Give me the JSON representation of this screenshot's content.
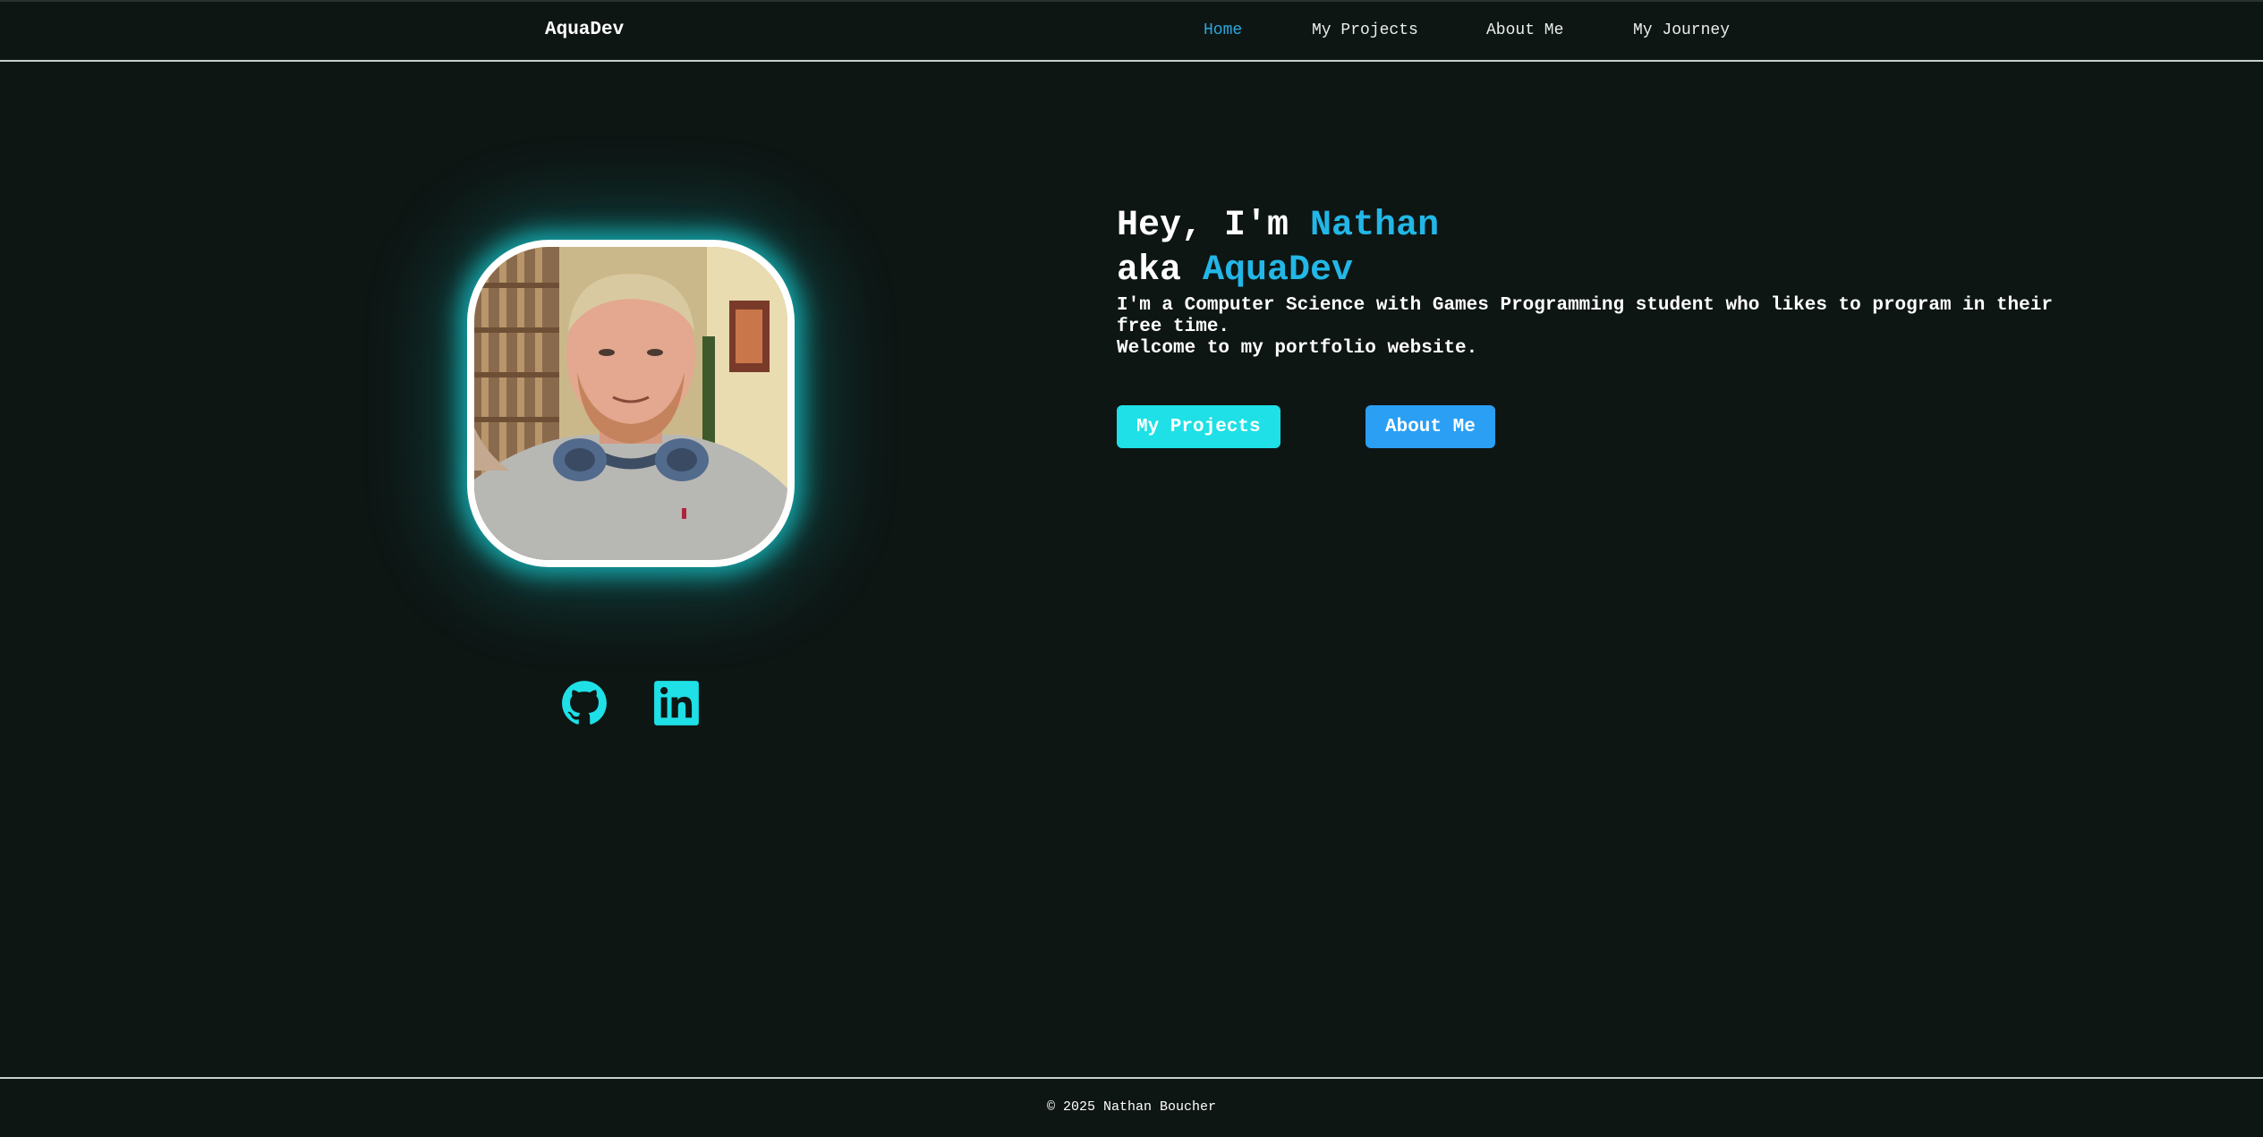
{
  "nav": {
    "brand": "AquaDev",
    "links": [
      {
        "label": "Home",
        "active": true
      },
      {
        "label": "My Projects",
        "active": false
      },
      {
        "label": "About Me",
        "active": false
      },
      {
        "label": "My Journey",
        "active": false
      }
    ]
  },
  "hero": {
    "line1_prefix": "Hey, I'm ",
    "name": "Nathan",
    "line2_prefix": "aka ",
    "alias": "AquaDev",
    "description_line1": "I'm a Computer Science with Games Programming student who likes to program in their free time.",
    "description_line2": "Welcome to my portfolio website.",
    "buttons": {
      "projects": "My Projects",
      "about": "About Me"
    }
  },
  "portrait": {
    "icon": "profile-photo"
  },
  "social": {
    "github_icon": "github-icon",
    "linkedin_icon": "linkedin-icon"
  },
  "footer": {
    "copyright": "© 2025 Nathan Boucher"
  },
  "colors": {
    "background": "#0e1614",
    "accent_cyan": "#1ee0e6",
    "accent_blue": "#2a9ff4",
    "highlight": "#22b7e6",
    "nav_active": "#2ba7dc"
  }
}
